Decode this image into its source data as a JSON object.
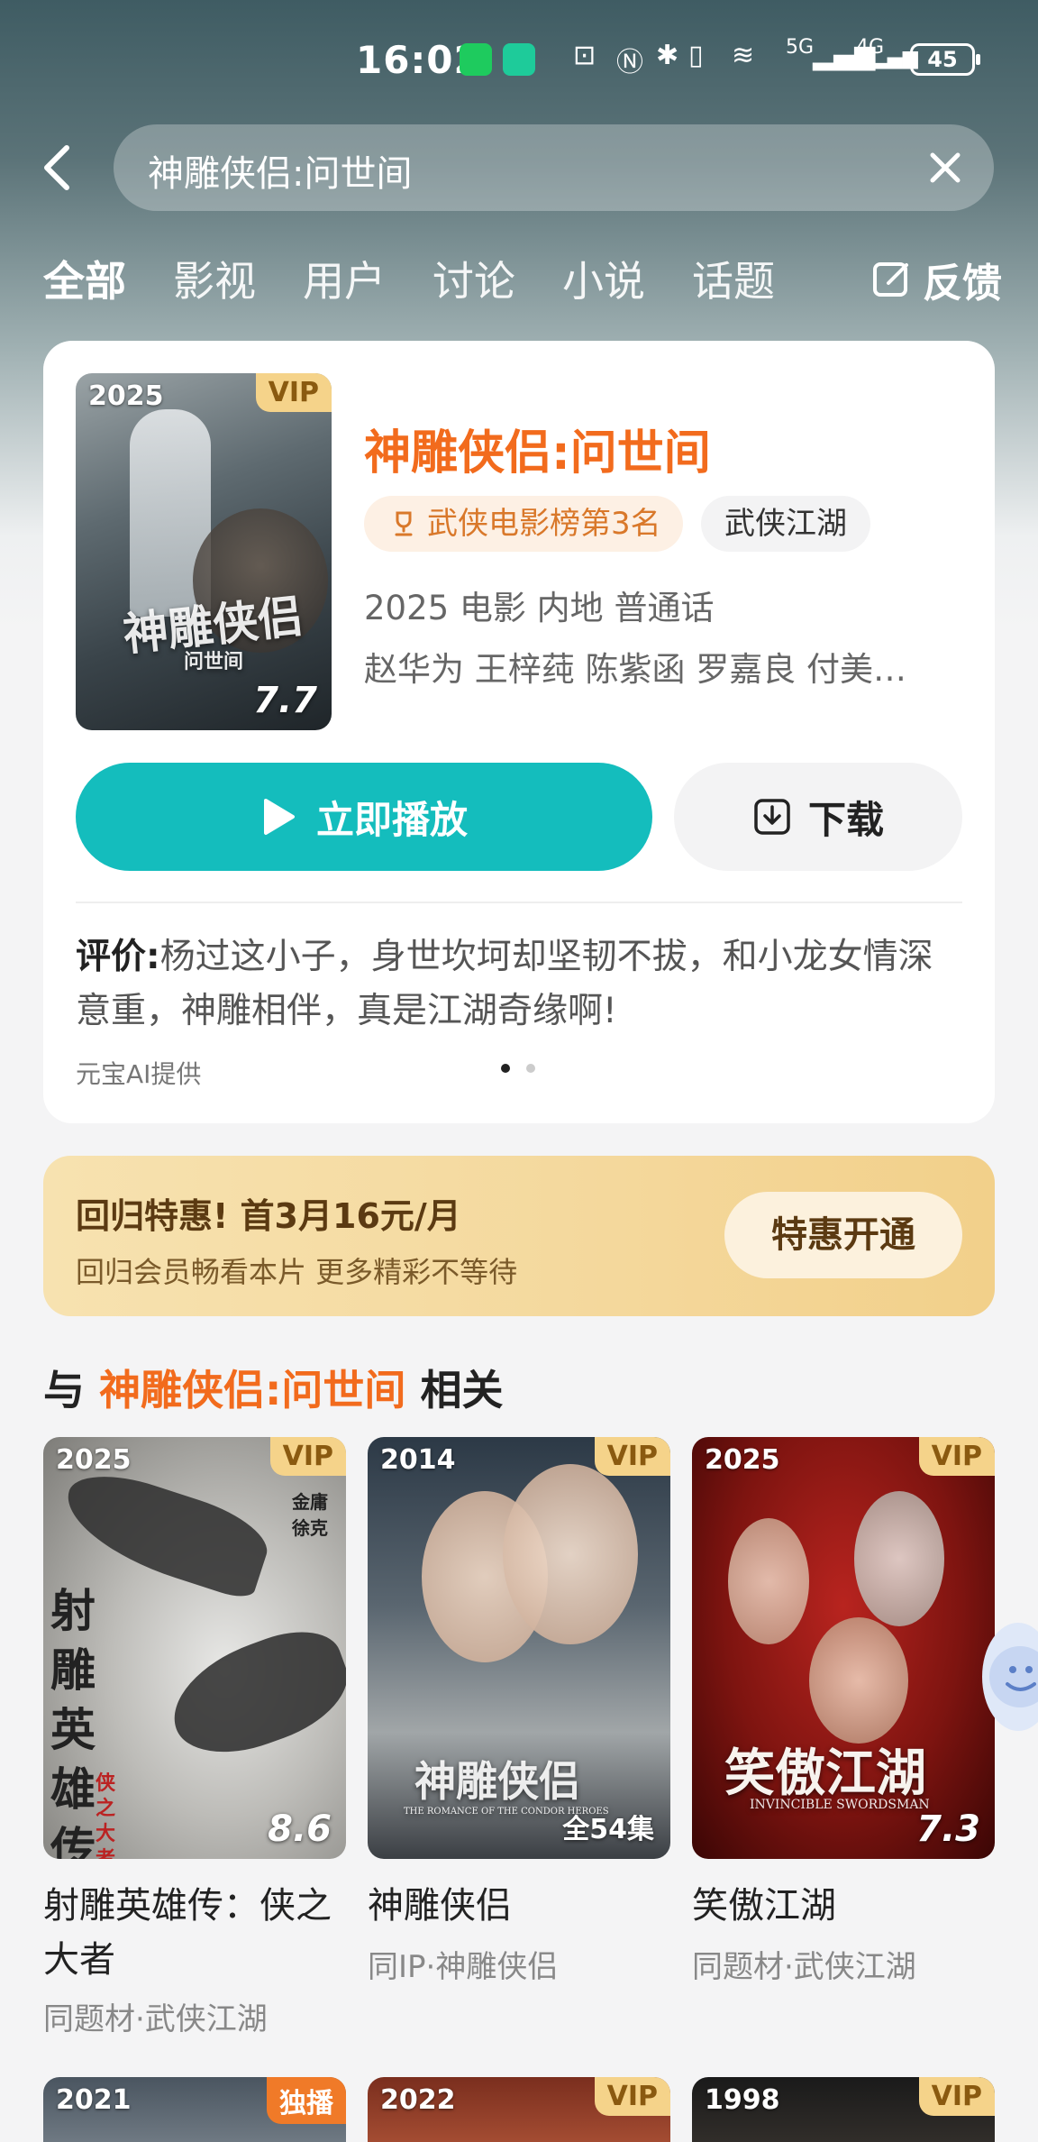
{
  "status_bar": {
    "time": "16:02",
    "network1": "5G",
    "network2": "4G",
    "battery": "45"
  },
  "search": {
    "query": "神雕侠侣:问世间"
  },
  "tabs": [
    "全部",
    "影视",
    "用户",
    "讨论",
    "小说",
    "话题"
  ],
  "feedback_label": "反馈",
  "main_result": {
    "year": "2025",
    "badge": "VIP",
    "score": "7.7",
    "poster_text": "神雕侠侣",
    "poster_subtext": "问世间",
    "title": "神雕侠侣:问世间",
    "rank_tag": "武侠电影榜第3名",
    "genre_tag": "武侠江湖",
    "meta": "2025 电影 内地 普通话",
    "cast": "赵华为 王梓莼 陈紫函 罗嘉良 付美…",
    "play_label": "立即播放",
    "download_label": "下载",
    "review_label": "评价:",
    "review_text": "杨过这小子，身世坎坷却坚韧不拔，和小龙女情深意重，神雕相伴，真是江湖奇缘啊!",
    "review_source": "元宝AI提供"
  },
  "promo": {
    "title": "回归特惠! 首3月16元/月",
    "subtitle": "回归会员畅看本片 更多精彩不等待",
    "button": "特惠开通"
  },
  "related": {
    "prefix": "与",
    "keyword": "神雕侠侣:问世间",
    "suffix": "相关",
    "items": [
      {
        "year": "2025",
        "badge": "VIP",
        "score": "8.6",
        "poster_text": "射雕英雄传",
        "poster_sub": "侠之大者",
        "poster_credit": "金庸 徐克",
        "name_line1": "射雕英雄传：侠之",
        "name_line2": "大者",
        "sub": "同题材·武侠江湖"
      },
      {
        "year": "2014",
        "badge": "VIP",
        "episodes": "全54集",
        "poster_text": "神雕侠侣",
        "poster_en": "THE ROMANCE OF THE CONDOR HEROES",
        "name_line1": "神雕侠侣",
        "sub": "同IP·神雕侠侣"
      },
      {
        "year": "2025",
        "badge": "VIP",
        "score": "7.3",
        "poster_text": "笑傲江湖",
        "poster_en": "INVINCIBLE SWORDSMAN",
        "name_line1": "笑傲江湖",
        "sub": "同题材·武侠江湖"
      }
    ],
    "next_row": [
      {
        "year": "2021",
        "badge": "独播"
      },
      {
        "year": "2022",
        "badge": "VIP"
      },
      {
        "year": "1998",
        "badge": "VIP"
      }
    ]
  },
  "colors": {
    "accent_orange": "#f26b1d",
    "play_teal": "#14bdbd",
    "vip_gold": "#f5d38a"
  }
}
